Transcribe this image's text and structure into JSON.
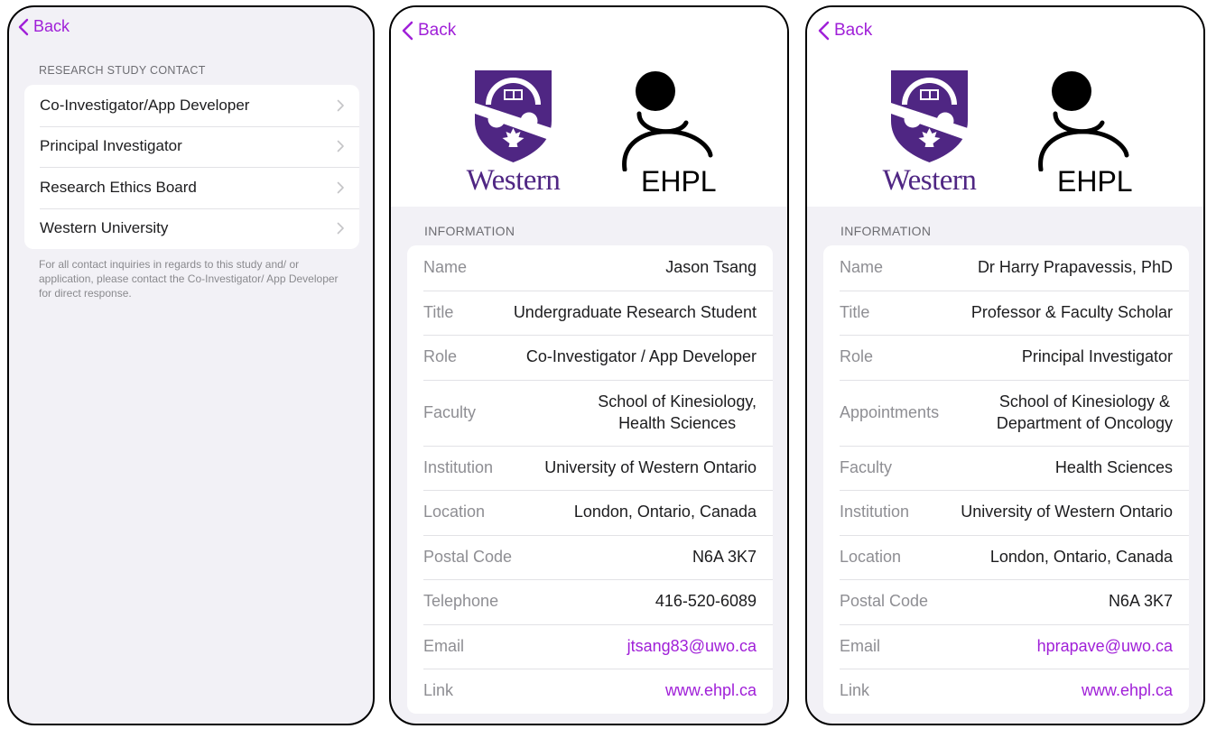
{
  "nav": {
    "back_label": "Back"
  },
  "contact_list": {
    "section_header": "RESEARCH STUDY CONTACT",
    "items": [
      {
        "label": "Co-Investigator/App Developer"
      },
      {
        "label": "Principal Investigator"
      },
      {
        "label": "Research Ethics Board"
      },
      {
        "label": "Western University"
      }
    ],
    "footer": "For all contact inquiries in regards to this study and/ or application, please contact the Co-Investigator/ App Developer for direct response."
  },
  "logos": {
    "western": "Western",
    "ehpl": "EHPL"
  },
  "detail_1": {
    "section_header": "INFORMATION",
    "rows": [
      {
        "key": "Name",
        "value": "Jason Tsang"
      },
      {
        "key": "Title",
        "value": "Undergraduate Research Student"
      },
      {
        "key": "Role",
        "value": "Co-Investigator / App Developer"
      },
      {
        "key": "Faculty",
        "value": "School of Kinesiology,\nHealth Sciences"
      },
      {
        "key": "Institution",
        "value": "University of Western Ontario"
      },
      {
        "key": "Location",
        "value": "London, Ontario, Canada"
      },
      {
        "key": "Postal Code",
        "value": "N6A 3K7"
      },
      {
        "key": "Telephone",
        "value": "416-520-6089"
      },
      {
        "key": "Email",
        "value": "jtsang83@uwo.ca"
      },
      {
        "key": "Link",
        "value": "www.ehpl.ca"
      }
    ]
  },
  "detail_2": {
    "section_header": "INFORMATION",
    "rows": [
      {
        "key": "Name",
        "value": "Dr Harry Prapavessis, PhD"
      },
      {
        "key": "Title",
        "value": "Professor & Faculty Scholar"
      },
      {
        "key": "Role",
        "value": "Principal Investigator"
      },
      {
        "key": "Appointments",
        "value": "School of Kinesiology &\nDepartment of Oncology"
      },
      {
        "key": "Faculty",
        "value": "Health Sciences"
      },
      {
        "key": "Institution",
        "value": "University of Western Ontario"
      },
      {
        "key": "Location",
        "value": "London, Ontario, Canada"
      },
      {
        "key": "Postal Code",
        "value": "N6A 3K7"
      },
      {
        "key": "Email",
        "value": "hprapave@uwo.ca"
      },
      {
        "key": "Link",
        "value": "www.ehpl.ca"
      }
    ]
  },
  "colors": {
    "accent": "#a020d8",
    "western_purple": "#4f2683",
    "background": "#f2f1f6"
  }
}
